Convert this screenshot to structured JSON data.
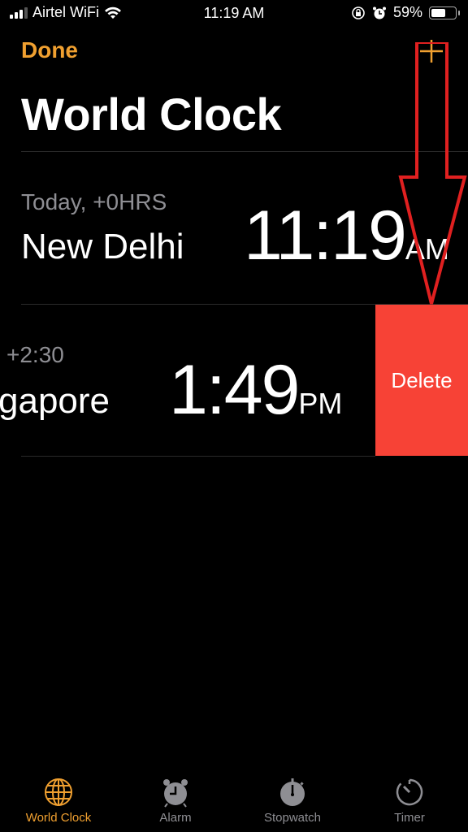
{
  "status_bar": {
    "carrier": "Airtel WiFi",
    "time": "11:19 AM",
    "battery_percent": "59%",
    "battery_level": 0.59,
    "icons": [
      "signal-icon",
      "wifi-icon",
      "rotation-lock-icon",
      "alarm-icon",
      "battery-icon"
    ]
  },
  "header": {
    "done_label": "Done",
    "add_icon": "plus-icon",
    "title": "World Clock"
  },
  "clocks": [
    {
      "offset": "Today, +0HRS",
      "city": "New Delhi",
      "time": "11:19",
      "ampm": "AM"
    },
    {
      "offset": "+2:30",
      "city": "gapore",
      "time": "1:49",
      "ampm": "PM",
      "delete_label": "Delete"
    }
  ],
  "annotation": {
    "type": "arrow",
    "color": "#E02020",
    "direction": "down"
  },
  "tab_bar": {
    "tabs": [
      {
        "label": "World Clock",
        "icon": "globe-icon",
        "active": true
      },
      {
        "label": "Alarm",
        "icon": "alarm-clock-icon",
        "active": false
      },
      {
        "label": "Stopwatch",
        "icon": "stopwatch-icon",
        "active": false
      },
      {
        "label": "Timer",
        "icon": "timer-icon",
        "active": false
      }
    ]
  },
  "colors": {
    "accent": "#F0A030",
    "delete": "#F74236",
    "inactive": "#8e8e93"
  }
}
